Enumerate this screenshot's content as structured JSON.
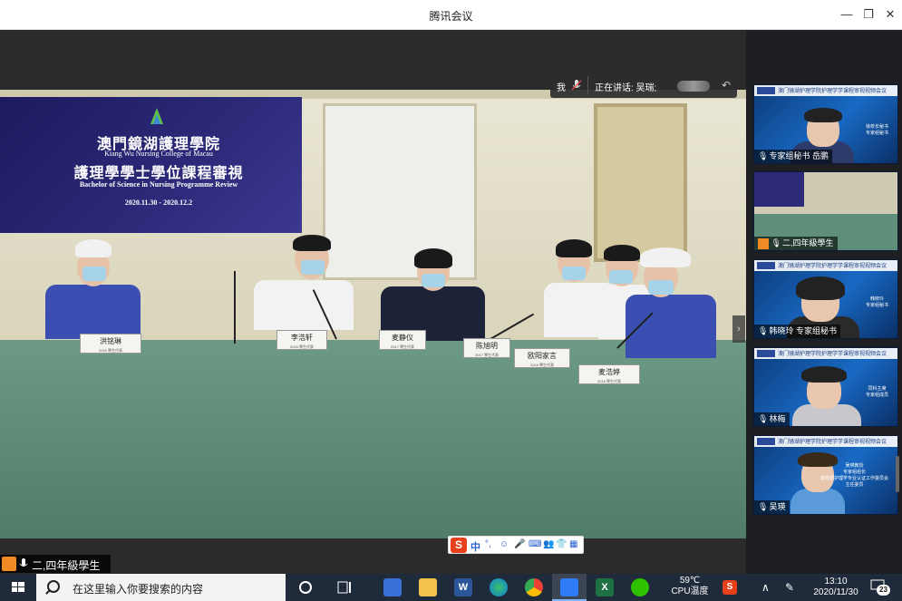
{
  "window": {
    "title": "腾讯会议",
    "minimize_glyph": "—",
    "restore_glyph": "❐",
    "close_glyph": "✕"
  },
  "speaker_bar": {
    "me_label": "我",
    "speaking_label": "正在讲话: 吴瑞;",
    "back_glyph": "↶"
  },
  "banner": {
    "cn_title": "澳門鏡湖護理學院",
    "en_title": "Kiang Wu Nursing College of Macau",
    "cn_subtitle": "護理學學士學位課程審視",
    "en_subtitle": "Bachelor of Science in Nursing Programme Review",
    "dates": "2020.11.30 - 2020.12.2"
  },
  "nameplates": [
    {
      "name": "洪铭琳",
      "sub": "2016 學生代表"
    },
    {
      "name": "李浩轩",
      "sub": "2016 學生代表"
    },
    {
      "name": "麦静仪",
      "sub": "2017 學生代表"
    },
    {
      "name": "陈旭明",
      "sub": "2017 學生代表"
    },
    {
      "name": "欧阳家言",
      "sub": "2018 學生代表"
    },
    {
      "name": "麦浩婷",
      "sub": "2018 學生代表"
    }
  ],
  "ime": {
    "logo": "S",
    "mode": "中",
    "icons": [
      "°,",
      "☺",
      "🎤",
      "⌨",
      "👥",
      "👕",
      "▦"
    ]
  },
  "self_tile": {
    "label": "二,四年級學生"
  },
  "participants": [
    {
      "name": "专家组秘书 岳鹏",
      "header": "澳门镜湖护理学院护理学学课程审视视频会议",
      "caption": [
        "徐校长秘书",
        "专家组秘书"
      ],
      "muted": false
    },
    {
      "name": "二,四年級學生",
      "header": "",
      "caption": [],
      "muted": false
    },
    {
      "name": "韩晓玲  专家组秘书",
      "header": "澳门镜湖护理学院护理学学课程审视视频会议",
      "caption": [
        "韩晓玲",
        "专家组秘书"
      ],
      "muted": false
    },
    {
      "name": "林梅",
      "header": "澳门镜湖护理学院护理学学课程审视视频会议",
      "caption": [
        "同科主席",
        "专家组成员"
      ],
      "muted": false
    },
    {
      "name": "吴瑛",
      "header": "澳门镜湖护理学院护理学学课程审视视频会议",
      "caption": [
        "吴瑛教授",
        "专家组组长",
        "教育部护理学专业认证工作委员会",
        "主任委员"
      ],
      "muted": false
    }
  ],
  "taskbar": {
    "search_placeholder": "在这里输入你要搜索的内容",
    "weather_temp": "59℃",
    "weather_label": "CPU温度",
    "time": "13:10",
    "date": "2020/11/30",
    "notification_count": "23",
    "tray_up": "∧",
    "pen_glyph": "✎"
  },
  "colors": {
    "banner_bg": "#1d1a5e",
    "tile_bg": "#1869c4",
    "taskbar_bg": "#1f2a3a",
    "accent": "#7fb6ff"
  }
}
